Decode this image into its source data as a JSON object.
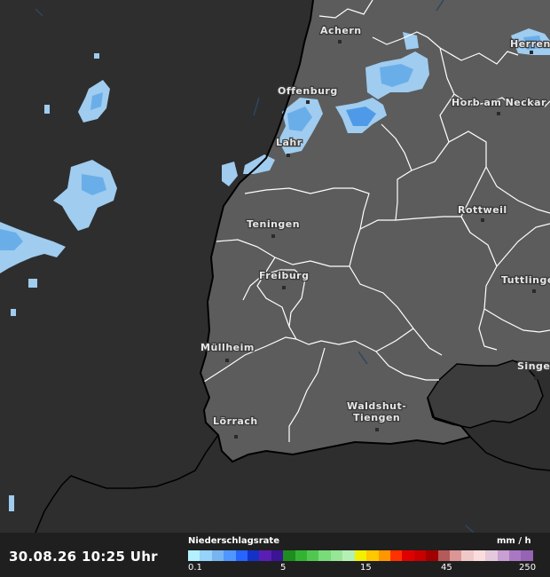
{
  "map": {
    "cities": [
      {
        "name": "Achern"
      },
      {
        "name": "Herrenberg"
      },
      {
        "name": "Offenburg"
      },
      {
        "name": "Horb am Neckar"
      },
      {
        "name": "Lahr"
      },
      {
        "name": "Rottweil"
      },
      {
        "name": "Teningen"
      },
      {
        "name": "Freiburg"
      },
      {
        "name": "Tuttlingen"
      },
      {
        "name": "Müllheim"
      },
      {
        "name": "Singen"
      },
      {
        "name": "Waldshut-Tiengen"
      },
      {
        "name": "Lörrach"
      }
    ],
    "colors": {
      "outside_region": "#2e2e2e",
      "region_fill": "#5c5c5c",
      "district_border": "#ffffff",
      "country_border": "#000000",
      "rain_light": "#a8d4f5",
      "rain_medium": "#5fa8ec"
    }
  },
  "footer": {
    "timestamp": "30.08.26 10:25 Uhr",
    "legend_title": "Niederschlagsrate",
    "legend_unit": "mm / h",
    "legend_ticks": [
      "0.1",
      "5",
      "15",
      "45",
      "250"
    ],
    "legend_colors": [
      "#b4f0ff",
      "#96d2fa",
      "#78b4f0",
      "#5096ff",
      "#2864ff",
      "#1432c8",
      "#5a1eb4",
      "#3c1496",
      "#1e8c1e",
      "#32b432",
      "#50c850",
      "#78dc78",
      "#96e696",
      "#b4f0b4",
      "#f0f000",
      "#ffc800",
      "#ff9600",
      "#ff3200",
      "#e10000",
      "#c80000",
      "#a00000",
      "#b45a5a",
      "#dc9696",
      "#f0c8c8",
      "#fadcdc",
      "#e6c8dc",
      "#c8a0d2",
      "#aa78c3",
      "#9664b4"
    ]
  }
}
